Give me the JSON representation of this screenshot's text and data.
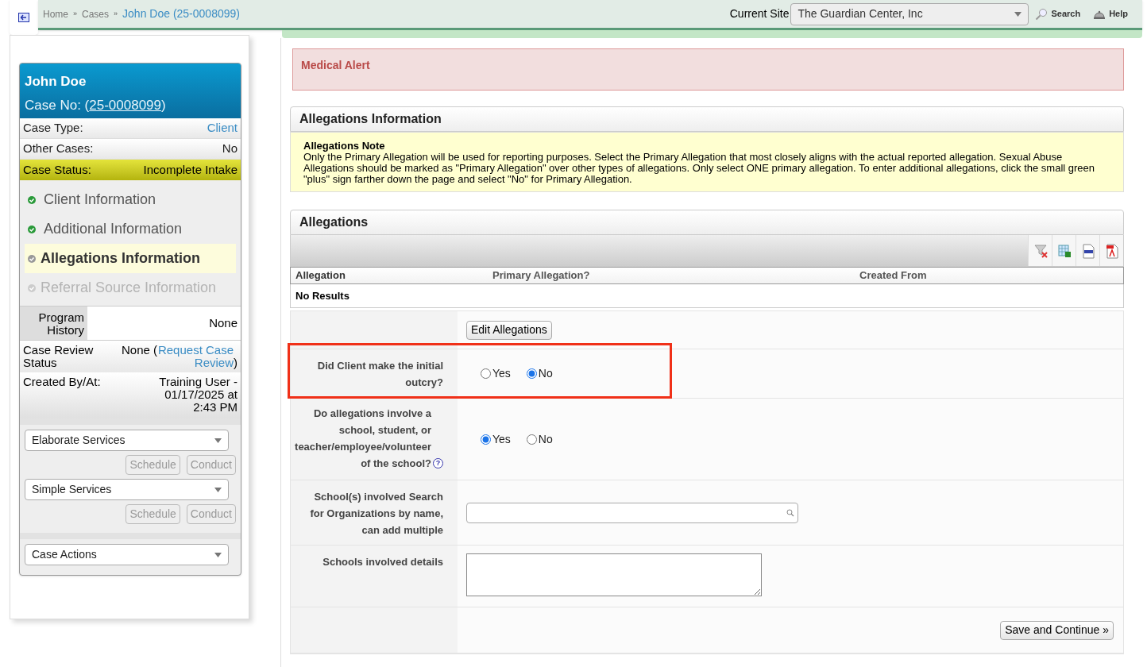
{
  "breadcrumb": [
    {
      "label": "Home",
      "current": false
    },
    {
      "separator": "»",
      "label": "Cases",
      "current": false
    },
    {
      "separator": "»",
      "label": "John Doe (25-0008099)",
      "current": true
    }
  ],
  "current_site": {
    "label": "Current Site",
    "value": "The Guardian Center, Inc"
  },
  "header_links": [
    {
      "label": "Search",
      "kind": "search"
    },
    {
      "label": "Help",
      "kind": "help"
    }
  ],
  "case_card": {
    "name": "John Doe",
    "case_no_prefix": "Case No: (",
    "case_no": "25-0008099",
    "case_no_suffix": ")"
  },
  "info_rows": [
    {
      "label": "Case Type:",
      "value": "Client",
      "kind": "link"
    },
    {
      "label": "Other Cases:",
      "value": "No",
      "kind": "plain"
    },
    {
      "label": "Case Status:",
      "value": "Incomplete Intake",
      "kind": "status"
    }
  ],
  "steps": [
    {
      "label": "Client Information",
      "done": true,
      "selected": false,
      "disabled": false
    },
    {
      "label": "Additional Information",
      "done": true,
      "selected": false,
      "disabled": false
    },
    {
      "label": "Allegations Information",
      "done": false,
      "selected": true,
      "disabled": false
    },
    {
      "label": "Referral Source Information",
      "done": false,
      "selected": false,
      "disabled": true
    }
  ],
  "program_history": {
    "label": "Program History",
    "value": "None"
  },
  "case_review": {
    "label": "Case Review Status",
    "value": "None (",
    "link": "Request Case Review",
    "suffix": ")"
  },
  "created": {
    "label": "Created By/At:",
    "value": "Training User - 01/17/2025 at 2:43 PM"
  },
  "service_groups": [
    {
      "select": "Elaborate Services",
      "buttons": [
        {
          "label": "Schedule",
          "disabled": true
        },
        {
          "label": "Conduct",
          "disabled": true
        }
      ]
    },
    {
      "select": "Simple Services",
      "buttons": [
        {
          "label": "Schedule",
          "disabled": true
        },
        {
          "label": "Conduct",
          "disabled": true
        }
      ]
    }
  ],
  "case_actions": "Case Actions",
  "medical_alert": "Medical Alert",
  "allegations_info": {
    "title": "Allegations Information",
    "note_title": "Allegations Note",
    "note": "Only the Primary Allegation will be used for reporting purposes. Select the Primary Allegation that most closely aligns with the actual reported allegation. Sexual Abuse Allegations should be marked as \"Primary Allegation\" over other types of allegations. Only select ONE primary allegation. To enter additional allegations, click the small green \"plus\" sign farther down the page and select \"No\" for Primary Allegation."
  },
  "allegations": {
    "title": "Allegations",
    "columns": [
      "Allegation",
      "Primary Allegation?",
      "Created From"
    ],
    "empty": "No Results"
  },
  "form_rows": [
    {
      "kind": "button",
      "value": "Edit Allegations"
    },
    {
      "kind": "radio",
      "label": "Did Client make the initial outcry?",
      "highlighted": true,
      "options": [
        {
          "label": "Yes",
          "selected": false
        },
        {
          "label": "No",
          "selected": true
        }
      ]
    },
    {
      "kind": "radio",
      "label": "Do allegations involve a school, student, or teacher/employee/volunteer of the school?",
      "highlighted": false,
      "help": "?",
      "options": [
        {
          "label": "Yes",
          "selected": true
        },
        {
          "label": "No",
          "selected": false
        }
      ]
    },
    {
      "kind": "search",
      "label": "School(s) involved Search for Organizations by name, can add multiple"
    },
    {
      "kind": "textarea",
      "label": "Schools involved details"
    },
    {
      "kind": "submit",
      "value": "Save and Continue »"
    }
  ]
}
